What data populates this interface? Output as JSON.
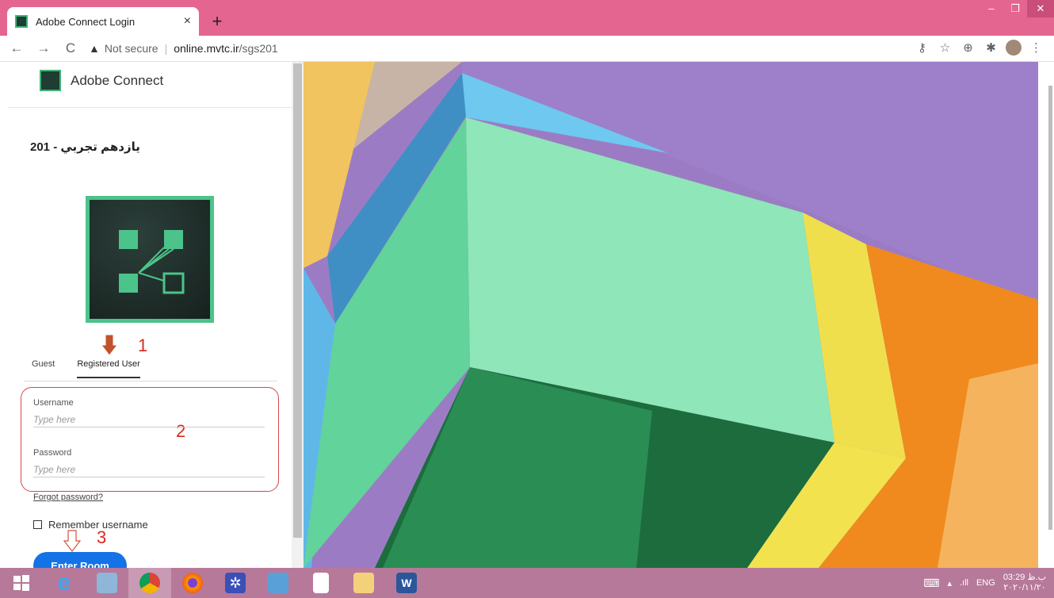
{
  "browser": {
    "tab_title": "Adobe Connect Login",
    "tab_close": "×",
    "new_tab": "+",
    "back": "←",
    "forward": "→",
    "reload": "C",
    "security_warning": "Not secure",
    "url_host": "online.mvtc.ir",
    "url_path": "/sgs201",
    "window_minimize": "–",
    "window_restore": "❐",
    "window_close": "✕"
  },
  "app": {
    "brand": "Adobe Connect",
    "room_name": "يازدهم تجربي - 201",
    "tabs": [
      {
        "label": "Guest",
        "selected": false
      },
      {
        "label": "Registered User",
        "selected": true
      }
    ],
    "username_label": "Username",
    "username_placeholder": "Type here",
    "password_label": "Password",
    "password_placeholder": "Type here",
    "forgot_password": "Forgot password?",
    "remember_username": "Remember username",
    "enter_button": "Enter Room"
  },
  "annotations": [
    "1",
    "2",
    "3"
  ],
  "taskbar": {
    "apps": [
      "windows-start",
      "internet-explorer",
      "network-monitor",
      "chrome",
      "firefox",
      "settings",
      "control-panel",
      "notepad",
      "file-explorer",
      "word"
    ],
    "language": "ENG",
    "time": "03:29 ب.ظ",
    "date": "۲۰۲۰/۱۱/۲۰"
  },
  "colors": {
    "chrome_tabbar": "#e4658f",
    "taskbar": "#b7799a",
    "enter_button": "#1473e6",
    "annotation_box": "#d34a4a",
    "adobe_connect_green": "#4cc38a"
  }
}
